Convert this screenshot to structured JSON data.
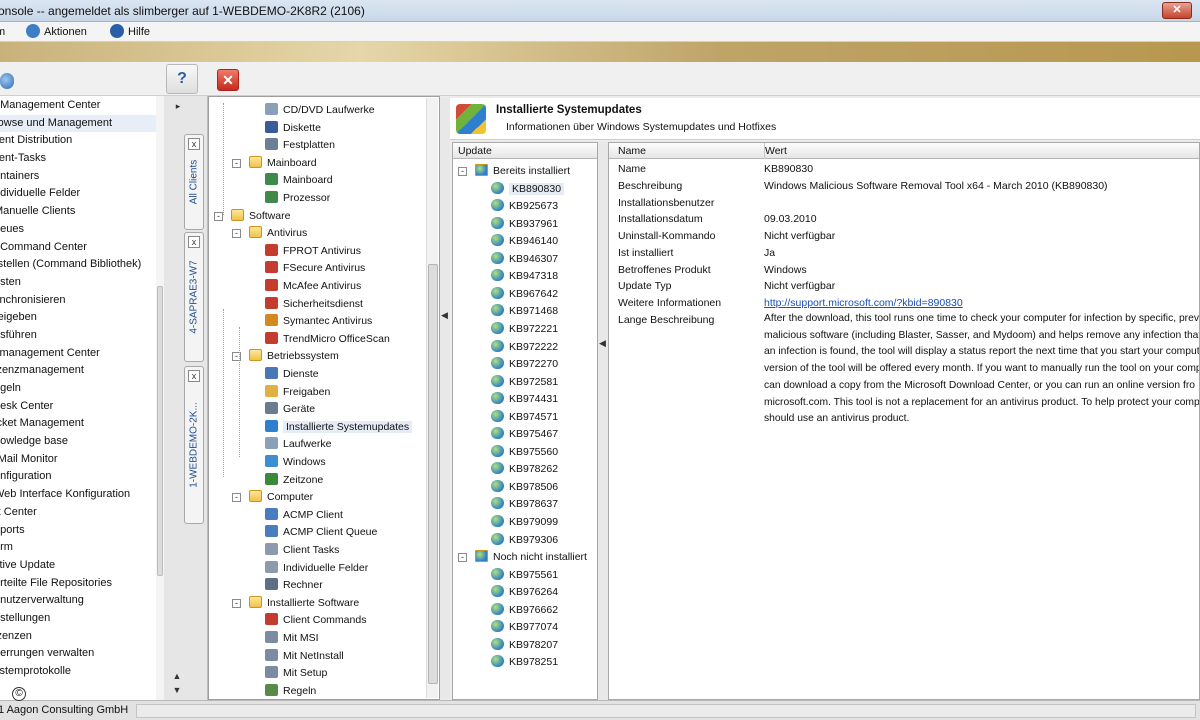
{
  "window": {
    "title": "onsole -- angemeldet als slimberger auf 1-WEBDEMO-2K8R2 (2106)",
    "close_glyph": "✕"
  },
  "menu": [
    {
      "label": "m",
      "icon": "",
      "color": ""
    },
    {
      "label": "Aktionen",
      "icon": "actions-icon",
      "color": "#3c7fc7"
    },
    {
      "label": "Hilfe",
      "icon": "help-icon",
      "color": "#2a5fa8"
    }
  ],
  "toolbar": {
    "help_glyph": "?",
    "close_glyph": "✕"
  },
  "leftnav": {
    "selected": "rowse und Management",
    "items": [
      "t Management Center",
      "rowse und Management",
      "lient Distribution",
      "lient-Tasks",
      "ontainers",
      "ndividuelle Felder",
      "Manuelle Clients",
      "ueues",
      "t Command Center",
      "rstellen (Command Bibliothek)",
      "esten",
      "ynchronisieren",
      "reigeben",
      "usführen",
      "zmanagement Center",
      "izenzmanagement",
      "egeln",
      "desk Center",
      "icket Management",
      "nowledge base",
      "-Mail Monitor",
      "onfiguration",
      "Web Interface Konfiguration",
      "rt Center",
      "eports",
      "orm",
      "ctive Update",
      "erteilte File Repositories",
      "enutzerverwaltung",
      "nstellungen",
      "izenzen",
      "perrungen verwalten",
      "ystemprotokolle"
    ]
  },
  "vtabs": [
    {
      "label": "All Clients",
      "close": "x"
    },
    {
      "label": "4-SAPRAE3-W7",
      "close": "x"
    },
    {
      "label": "1-WEBDEMO-2K...",
      "close": "x"
    }
  ],
  "tree": {
    "selected": "Installierte Systemupdates",
    "rows": [
      {
        "label": "CD/DVD Laufwerke",
        "level": 3,
        "icon": "drive-icon",
        "color": "#8aa0b8",
        "exp": ""
      },
      {
        "label": "Diskette",
        "level": 3,
        "icon": "floppy-icon",
        "color": "#3a5a9a",
        "exp": ""
      },
      {
        "label": "Festplatten",
        "level": 3,
        "icon": "harddisk-icon",
        "color": "#6d7f96",
        "exp": ""
      },
      {
        "label": "Mainboard",
        "level": 2,
        "icon": "folder-icon",
        "color": "folder",
        "exp": "-"
      },
      {
        "label": "Mainboard",
        "level": 3,
        "icon": "mainboard-icon",
        "color": "#3f8a4a",
        "exp": ""
      },
      {
        "label": "Prozessor",
        "level": 3,
        "icon": "cpu-icon",
        "color": "#3f8a4a",
        "exp": ""
      },
      {
        "label": "Software",
        "level": 1,
        "icon": "folder-icon",
        "color": "folder",
        "exp": "-"
      },
      {
        "label": "Antivirus",
        "level": 2,
        "icon": "folder-icon",
        "color": "folder",
        "exp": "-"
      },
      {
        "label": "FPROT Antivirus",
        "level": 3,
        "icon": "antivirus-icon",
        "color": "#c33c2e",
        "exp": ""
      },
      {
        "label": "FSecure Antivirus",
        "level": 3,
        "icon": "antivirus-icon",
        "color": "#c33c2e",
        "exp": ""
      },
      {
        "label": "McAfee Antivirus",
        "level": 3,
        "icon": "antivirus-icon",
        "color": "#c33c2e",
        "exp": ""
      },
      {
        "label": "Sicherheitsdienst",
        "level": 3,
        "icon": "security-icon",
        "color": "#c33c2e",
        "exp": ""
      },
      {
        "label": "Symantec Antivirus",
        "level": 3,
        "icon": "antivirus-icon",
        "color": "#d28a1e",
        "exp": ""
      },
      {
        "label": "TrendMicro OfficeScan",
        "level": 3,
        "icon": "antivirus-icon",
        "color": "#c33c2e",
        "exp": ""
      },
      {
        "label": "Betriebssystem",
        "level": 2,
        "icon": "folder-icon",
        "color": "folder",
        "exp": "-"
      },
      {
        "label": "Dienste",
        "level": 3,
        "icon": "services-icon",
        "color": "#4a76b8",
        "exp": ""
      },
      {
        "label": "Freigaben",
        "level": 3,
        "icon": "shares-icon",
        "color": "#e0b040",
        "exp": ""
      },
      {
        "label": "Geräte",
        "level": 3,
        "icon": "devices-icon",
        "color": "#6a7c90",
        "exp": ""
      },
      {
        "label": "Installierte Systemupdates",
        "level": 3,
        "icon": "updates-icon",
        "color": "#2f7fd0",
        "exp": ""
      },
      {
        "label": "Laufwerke",
        "level": 3,
        "icon": "drive-icon",
        "color": "#8aa0b8",
        "exp": ""
      },
      {
        "label": "Windows",
        "level": 3,
        "icon": "windows-icon",
        "color": "#3b8ed4",
        "exp": ""
      },
      {
        "label": "Zeitzone",
        "level": 3,
        "icon": "globe-icon",
        "color": "#3a8a3a",
        "exp": ""
      },
      {
        "label": "Computer",
        "level": 2,
        "icon": "folder-icon",
        "color": "folder",
        "exp": "-"
      },
      {
        "label": "ACMP Client",
        "level": 3,
        "icon": "client-icon",
        "color": "#4a7cc0",
        "exp": ""
      },
      {
        "label": "ACMP Client Queue",
        "level": 3,
        "icon": "queue-icon",
        "color": "#4a7cc0",
        "exp": ""
      },
      {
        "label": "Client Tasks",
        "level": 3,
        "icon": "tasks-icon",
        "color": "#8c9aae",
        "exp": ""
      },
      {
        "label": "Individuelle Felder",
        "level": 3,
        "icon": "fields-icon",
        "color": "#8c9aae",
        "exp": ""
      },
      {
        "label": "Rechner",
        "level": 3,
        "icon": "computer-icon",
        "color": "#5d6e86",
        "exp": ""
      },
      {
        "label": "Installierte Software",
        "level": 2,
        "icon": "folder-icon",
        "color": "folder",
        "exp": "-"
      },
      {
        "label": "Client Commands",
        "level": 3,
        "icon": "commands-icon",
        "color": "#c33c2e",
        "exp": ""
      },
      {
        "label": "Mit MSI",
        "level": 3,
        "icon": "msi-icon",
        "color": "#7a8ba2",
        "exp": ""
      },
      {
        "label": "Mit NetInstall",
        "level": 3,
        "icon": "netinstall-icon",
        "color": "#7a8ba2",
        "exp": ""
      },
      {
        "label": "Mit Setup",
        "level": 3,
        "icon": "setup-icon",
        "color": "#7a8ba2",
        "exp": ""
      },
      {
        "label": "Regeln",
        "level": 3,
        "icon": "rules-icon",
        "color": "#5a8a4a",
        "exp": ""
      }
    ]
  },
  "right_header": {
    "title": "Installierte Systemupdates",
    "subtitle": "Informationen über Windows Systemupdates und Hotfixes"
  },
  "updates": {
    "column": "Update",
    "selected": "KB890830",
    "groups": [
      {
        "label": "Bereits installiert",
        "items": [
          "KB890830",
          "KB925673",
          "KB937961",
          "KB946140",
          "KB946307",
          "KB947318",
          "KB967642",
          "KB971468",
          "KB972221",
          "KB972222",
          "KB972270",
          "KB972581",
          "KB974431",
          "KB974571",
          "KB975467",
          "KB975560",
          "KB978262",
          "KB978506",
          "KB978637",
          "KB979099",
          "KB979306"
        ]
      },
      {
        "label": "Noch nicht installiert",
        "items": [
          "KB975561",
          "KB976264",
          "KB976662",
          "KB977074",
          "KB978207",
          "KB978251"
        ]
      }
    ]
  },
  "details": {
    "col_name": "Name",
    "col_value": "Wert",
    "rows": [
      {
        "name": "Name",
        "value": "KB890830",
        "link": false
      },
      {
        "name": "Beschreibung",
        "value": "Windows Malicious Software Removal Tool x64 - March 2010 (KB890830)",
        "link": false
      },
      {
        "name": "Installationsbenutzer",
        "value": "",
        "link": false
      },
      {
        "name": "Installationsdatum",
        "value": "09.03.2010",
        "link": false
      },
      {
        "name": "Uninstall-Kommando",
        "value": "Nicht verfügbar",
        "link": false
      },
      {
        "name": "Ist installiert",
        "value": "Ja",
        "link": false
      },
      {
        "name": "Betroffenes Produkt",
        "value": "Windows",
        "link": false
      },
      {
        "name": "Update Typ",
        "value": "Nicht verfügbar",
        "link": false
      },
      {
        "name": "Weitere Informationen",
        "value": "http://support.microsoft.com/?kbid=890830",
        "link": true
      },
      {
        "name": "Lange Beschreibung",
        "value": "",
        "link": false
      }
    ],
    "long_description": [
      "After the download, this tool runs one time to check your computer for infection by specific, prev",
      "malicious software (including Blaster, Sasser, and Mydoom) and helps remove any infection that",
      "an infection is found, the tool will display a status report the next time that you start your comput",
      "version of the tool will be offered every month. If you want to manually run the tool on your comp",
      "can download a copy from the Microsoft Download Center, or you can run an online version fro",
      "microsoft.com. This tool is not a replacement for an antivirus product. To help protect your comp",
      "should use an antivirus product."
    ]
  },
  "statusbar": {
    "text": "1 Aagon Consulting GmbH",
    "copyright_glyph": "©"
  }
}
